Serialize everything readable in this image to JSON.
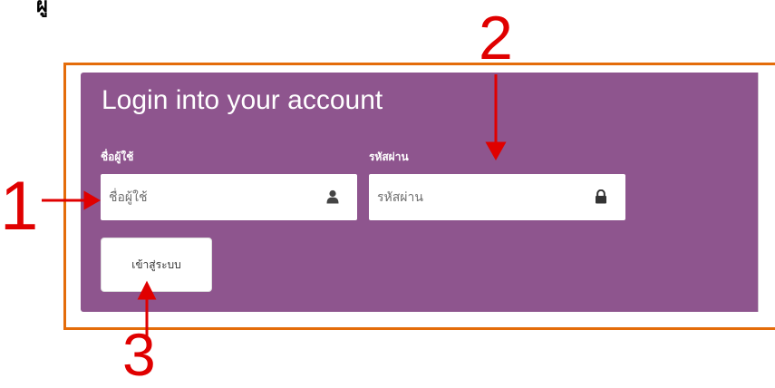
{
  "top_text": "ผู้",
  "login": {
    "title": "Login into your account",
    "username_label": "ชื่อผู้ใช้",
    "username_placeholder": "ชื่อผู้ใช้",
    "password_label": "รหัสผ่าน",
    "password_placeholder": "รหัสผ่าน",
    "submit_label": "เข้าสู่ระบบ"
  },
  "annotations": {
    "marker_1": "1",
    "marker_2": "2",
    "marker_3": "3",
    "color": "#e00000",
    "frame_color": "#e46c0a",
    "card_color": "#8e558e"
  },
  "icons": {
    "username_icon": "user-icon",
    "password_icon": "lock-icon"
  }
}
